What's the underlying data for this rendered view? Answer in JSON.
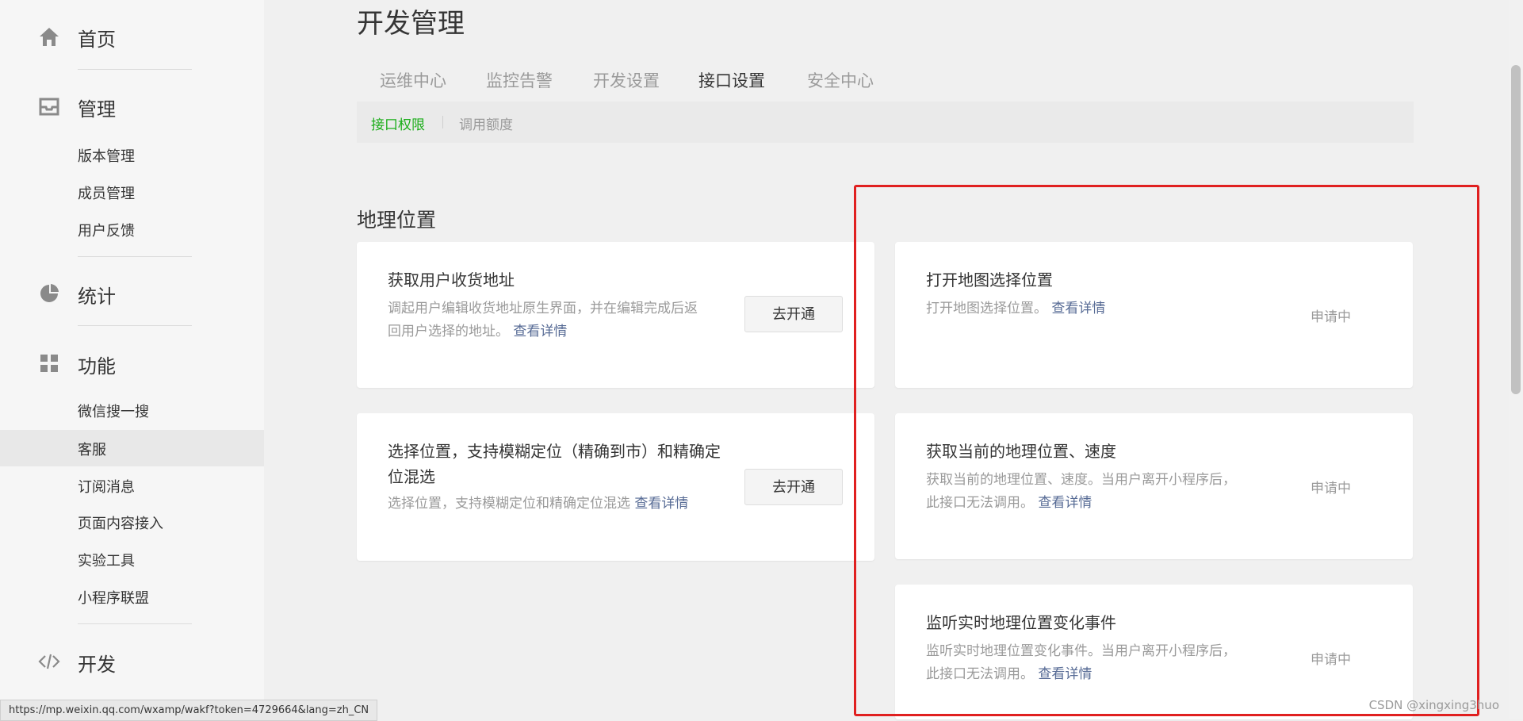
{
  "sidebar": {
    "home": "首页",
    "manage": "管理",
    "manage_items": [
      "版本管理",
      "成员管理",
      "用户反馈"
    ],
    "stats": "统计",
    "features": "功能",
    "feature_items": [
      "微信搜一搜",
      "客服",
      "订阅消息",
      "页面内容接入",
      "实验工具",
      "小程序联盟"
    ],
    "dev": "开发"
  },
  "page": {
    "title": "开发管理",
    "tabs": [
      "运维中心",
      "监控告警",
      "开发设置",
      "接口设置",
      "安全中心"
    ],
    "subtabs": [
      "接口权限",
      "调用额度"
    ],
    "section_title": "地理位置"
  },
  "cards": {
    "c1": {
      "title": "获取用户收货地址",
      "desc": "调起用户编辑收货地址原生界面，并在编辑完成后返回用户选择的地址。",
      "link": "查看详情",
      "button": "去开通"
    },
    "c2": {
      "title": "打开地图选择位置",
      "desc": "打开地图选择位置。",
      "link": "查看详情",
      "status": "申请中"
    },
    "c3": {
      "title": "选择位置，支持模糊定位（精确到市）和精确定位混选",
      "desc": "选择位置，支持模糊定位和精确定位混选",
      "link": "查看详情",
      "button": "去开通"
    },
    "c4": {
      "title": "获取当前的地理位置、速度",
      "desc": "获取当前的地理位置、速度。当用户离开小程序后，此接口无法调用。",
      "link": "查看详情",
      "status": "申请中"
    },
    "c5": {
      "title": "监听实时地理位置变化事件",
      "desc": "监听实时地理位置变化事件。当用户离开小程序后，此接口无法调用。",
      "link": "查看详情",
      "status": "申请中"
    }
  },
  "status_url": "https://mp.weixin.qq.com/wxamp/wakf?token=4729664&lang=zh_CN",
  "watermark": "CSDN @xingxing3huo"
}
